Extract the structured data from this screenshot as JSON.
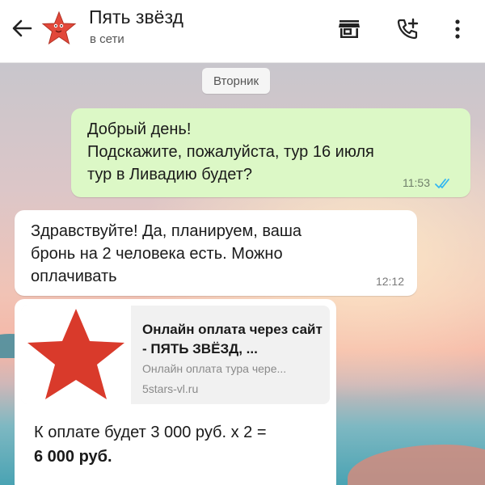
{
  "header": {
    "title": "Пять звёзд",
    "status": "в сети",
    "icons": [
      "back-arrow-icon",
      "starfish-avatar",
      "shop-icon",
      "add-call-icon",
      "more-icon"
    ]
  },
  "chat": {
    "date_chip": "Вторник",
    "outgoing": {
      "text": "Добрый день!\nПодскажите, пожалуйста, тур 16 июля\nтур в Ливадию будет?",
      "time": "11:53"
    },
    "incoming": {
      "text": "Здравствуйте! Да, планируем, ваша\nбронь на 2 человека есть. Можно\nоплачивать",
      "time": "12:12"
    },
    "link_message": {
      "preview_title": "Онлайн оплата через сайт - ПЯТЬ ЗВЁЗД, ...",
      "preview_desc": "Онлайн оплата тура чере...",
      "preview_domain": "5stars-vl.ru",
      "pay_line": "К оплате будет 3 000 руб. х 2 =",
      "pay_total": "6 000 руб."
    }
  },
  "colors": {
    "outgoing_bubble": "#dcf8c6",
    "incoming_bubble": "#ffffff",
    "read_ticks": "#34b7f1",
    "star_red": "#d93a2b"
  }
}
